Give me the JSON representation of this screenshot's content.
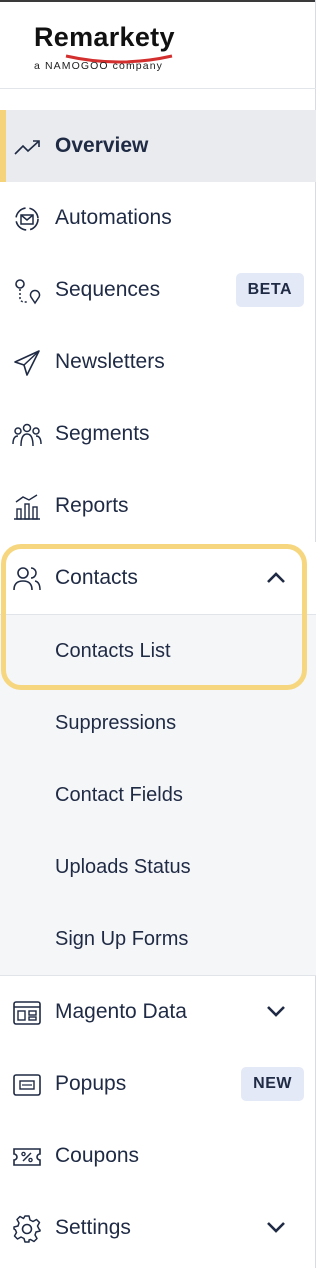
{
  "brand": {
    "name": "Remarkety",
    "tagline": "a NAMOGOO company"
  },
  "nav": {
    "overview": "Overview",
    "automations": "Automations",
    "sequences": "Sequences",
    "sequences_badge": "BETA",
    "newsletters": "Newsletters",
    "segments": "Segments",
    "reports": "Reports",
    "contacts": "Contacts",
    "contacts_sub": [
      "Contacts List",
      "Suppressions",
      "Contact Fields",
      "Uploads Status",
      "Sign Up Forms"
    ],
    "magento": "Magento Data",
    "popups": "Popups",
    "popups_badge": "NEW",
    "coupons": "Coupons",
    "settings": "Settings"
  },
  "colors": {
    "accent": "#f5d37a",
    "highlight": "#f6d77f",
    "active_bg": "#e9ebee",
    "badge_bg": "#e3e9f6",
    "logo_arc": "#d32f2f"
  },
  "icons": {
    "overview": "trend-up-icon",
    "automations": "automation-mail-icon",
    "sequences": "route-pin-icon",
    "newsletters": "paper-plane-icon",
    "segments": "people-group-icon",
    "reports": "bar-chart-icon",
    "contacts": "users-icon",
    "magento": "data-grid-icon",
    "popups": "popup-window-icon",
    "coupons": "percent-ticket-icon",
    "settings": "gear-icon"
  }
}
